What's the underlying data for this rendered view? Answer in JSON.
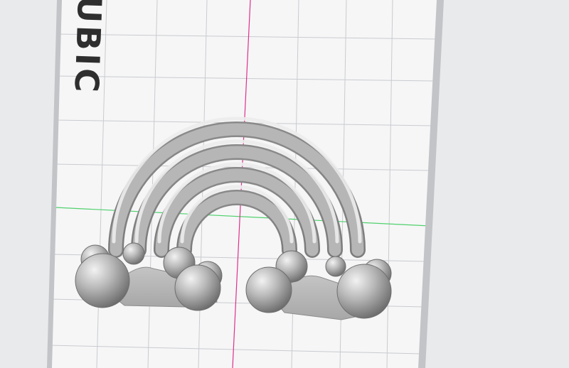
{
  "viewport": {
    "background": "#e9eaec",
    "plate_color": "#f6f6f7",
    "grid_color": "#c9cbcf",
    "frame_color": "#c2c4c7",
    "y_axis_color": "#e0308a",
    "x_axis_color": "#4fd16b"
  },
  "bed_logo": {
    "text": "UBIC"
  },
  "model": {
    "name": "rainbow-with-clouds",
    "shade_color": "#9a9a9a"
  }
}
